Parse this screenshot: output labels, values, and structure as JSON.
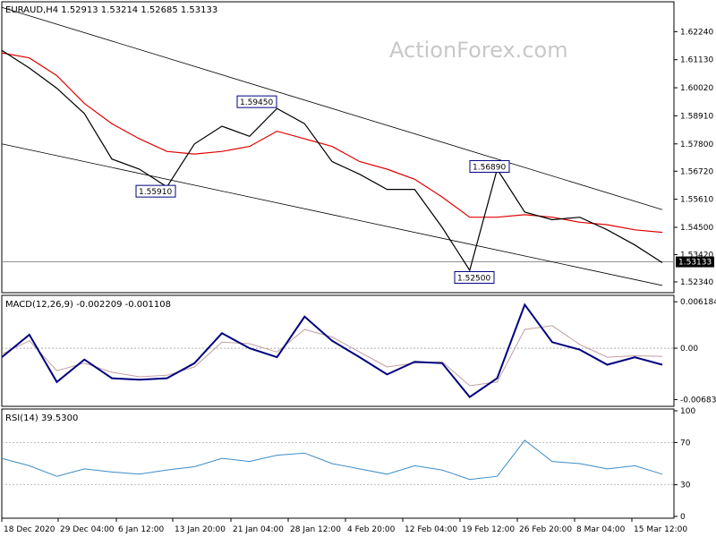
{
  "chart_data": [
    {
      "type": "line",
      "panel": "price",
      "header": "EURAUD,H4 1.52913 1.53214 1.52685 1.53133",
      "watermark": "ActionForex.com",
      "ylim": [
        1.5195,
        1.6335
      ],
      "yticks": [
        "1.62240",
        "1.61130",
        "1.60020",
        "1.58910",
        "1.57800",
        "1.56720",
        "1.55610",
        "1.54500",
        "1.53420",
        "1.52340"
      ],
      "last_price": "1.53133",
      "x": [
        "18 Dec 2020",
        "29 Dec 04:00",
        "6 Jan 12:00",
        "13 Jan 20:00",
        "21 Jan 04:00",
        "28 Jan 12:00",
        "4 Feb 20:00",
        "12 Feb 04:00",
        "19 Feb 12:00",
        "26 Feb 20:00",
        "8 Mar 04:00",
        "15 Mar 12:00"
      ],
      "series": [
        {
          "values": [
            1.615,
            1.608,
            1.6,
            1.59,
            1.572,
            1.568,
            1.561,
            1.578,
            1.585,
            1.581,
            1.592,
            1.586,
            1.571,
            1.566,
            1.56,
            1.56,
            1.545,
            1.528,
            1.568,
            1.551,
            1.548,
            1.549,
            1.544,
            1.538,
            1.531
          ]
        },
        {
          "values": [
            1.614,
            1.612,
            1.605,
            1.594,
            1.586,
            1.58,
            1.575,
            1.574,
            1.575,
            1.577,
            1.583,
            1.58,
            1.577,
            1.571,
            1.568,
            1.564,
            1.557,
            1.549,
            1.549,
            1.55,
            1.549,
            1.547,
            1.546,
            1.544,
            1.543
          ]
        }
      ],
      "annotations": [
        {
          "label": "1.59450",
          "value": 1.5945
        },
        {
          "label": "1.55910",
          "value": 1.5591
        },
        {
          "label": "1.56890",
          "value": 1.5689
        },
        {
          "label": "1.52500",
          "value": 1.525
        }
      ],
      "channel": {
        "upper": [
          [
            0,
            1.632
          ],
          [
            24,
            1.552
          ]
        ],
        "lower": [
          [
            0,
            1.578
          ],
          [
            24,
            1.522
          ]
        ]
      },
      "colors": {
        "price": "#000000",
        "ma": "#e00000",
        "channel": "#000000",
        "hline": "#808080"
      }
    },
    {
      "type": "line",
      "panel": "macd",
      "header": "MACD(12,26,9) -0.002209 -0.001108",
      "ylim": [
        -0.0075,
        0.0068
      ],
      "yticks": [
        "0.006184",
        "0.00",
        "-0.006837"
      ],
      "series": [
        {
          "values": [
            -0.0012,
            0.0018,
            -0.0045,
            -0.0015,
            -0.004,
            -0.0042,
            -0.004,
            -0.002,
            0.002,
            0.0,
            -0.0012,
            0.0042,
            0.001,
            -0.0012,
            -0.0035,
            -0.0018,
            -0.002,
            -0.0065,
            -0.004,
            0.0058,
            0.0008,
            -0.0002,
            -0.0022,
            -0.0012,
            -0.0022
          ]
        },
        {
          "values": [
            -0.0008,
            0.001,
            -0.003,
            -0.002,
            -0.0032,
            -0.0038,
            -0.0036,
            -0.0025,
            0.0008,
            0.0006,
            -0.0005,
            0.0025,
            0.0015,
            -0.0005,
            -0.0025,
            -0.002,
            -0.0018,
            -0.005,
            -0.0045,
            0.0025,
            0.003,
            0.0005,
            -0.0012,
            -0.001,
            -0.0011
          ]
        }
      ],
      "colors": {
        "macd": "#000080",
        "signal": "#c0a0a0",
        "zero": "#808080"
      }
    },
    {
      "type": "line",
      "panel": "rsi",
      "header": "RSI(14) 39.5300",
      "ylim": [
        0,
        100
      ],
      "yticks": [
        "100",
        "70",
        "30",
        "0"
      ],
      "levels": [
        70,
        30
      ],
      "series": [
        {
          "values": [
            55,
            48,
            38,
            45,
            42,
            40,
            44,
            47,
            55,
            52,
            58,
            60,
            50,
            45,
            40,
            48,
            44,
            35,
            38,
            72,
            52,
            50,
            45,
            48,
            40
          ]
        }
      ],
      "colors": {
        "rsi": "#3c8cc8",
        "levels": "#a0a0a0"
      }
    }
  ]
}
